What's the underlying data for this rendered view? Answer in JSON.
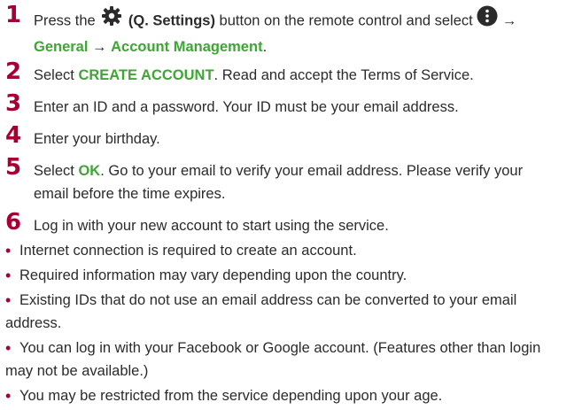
{
  "steps": [
    {
      "num": "1",
      "a": "Press the ",
      "b": " (Q. Settings)",
      "c": " button on the remote control and select ",
      "arrow1": " →",
      "general": "General",
      "arrow2": " → ",
      "account": "Account Management",
      "end": "."
    },
    {
      "num": "2",
      "pre": "Select ",
      "em": "CREATE ACCOUNT",
      "post": ". Read and accept the Terms of Service."
    },
    {
      "num": "3",
      "text": "Enter an ID and a password. Your ID must be your email address."
    },
    {
      "num": "4",
      "text": "Enter your birthday."
    },
    {
      "num": "5",
      "pre": "Select ",
      "em": "OK",
      "post": ". Go to your email to verify your email address. Please verify your",
      "line2": "email before the time expires."
    },
    {
      "num": "6",
      "text": "Log in with your new account to start using the service."
    }
  ],
  "bullets": [
    {
      "dot": "•",
      "text": "Internet connection is required to create an account."
    },
    {
      "dot": "•",
      "text": "Required information may vary depending upon the country."
    },
    {
      "dot": "•",
      "line1": "Existing IDs that do not use an email address can be converted to your email",
      "line2": "address."
    },
    {
      "dot": "•",
      "line1": "You can log in with your Facebook or Google account. (Features other than login",
      "line2": "may not be available.)"
    },
    {
      "dot": "•",
      "text": "You may be restricted from the service depending upon your age."
    }
  ],
  "icons": {
    "settings": "gear-icon",
    "more": "vertical-dots-icon"
  },
  "colors": {
    "step_number": "#a50034",
    "highlight": "#3fa535",
    "text": "#2b2b2b"
  }
}
